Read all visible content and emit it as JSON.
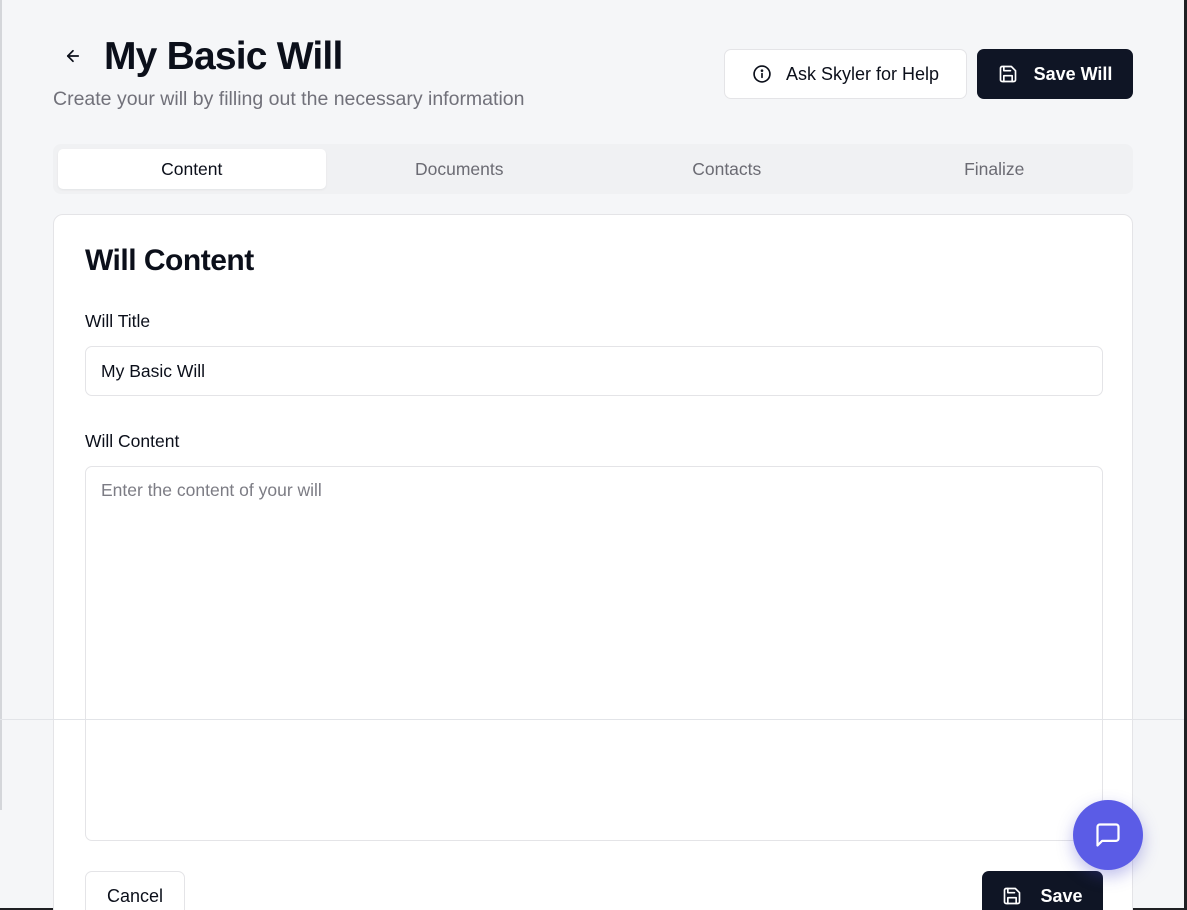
{
  "header": {
    "title": "My Basic Will",
    "subtitle": "Create your will by filling out the necessary information",
    "help_label": "Ask Skyler for Help",
    "save_will_label": "Save Will"
  },
  "tabs": [
    {
      "label": "Content",
      "active": true
    },
    {
      "label": "Documents",
      "active": false
    },
    {
      "label": "Contacts",
      "active": false
    },
    {
      "label": "Finalize",
      "active": false
    }
  ],
  "form": {
    "section_title": "Will Content",
    "title_label": "Will Title",
    "title_value": "My Basic Will",
    "content_label": "Will Content",
    "content_placeholder": "Enter the content of your will",
    "content_value": "",
    "cancel_label": "Cancel",
    "save_label": "Save"
  },
  "icons": {
    "back": "arrow-left-icon",
    "help": "info-icon",
    "save": "save-icon",
    "chat": "chat-icon"
  },
  "colors": {
    "primary": "#0f1525",
    "accent": "#5b5ce6",
    "background": "#f5f6f8"
  }
}
